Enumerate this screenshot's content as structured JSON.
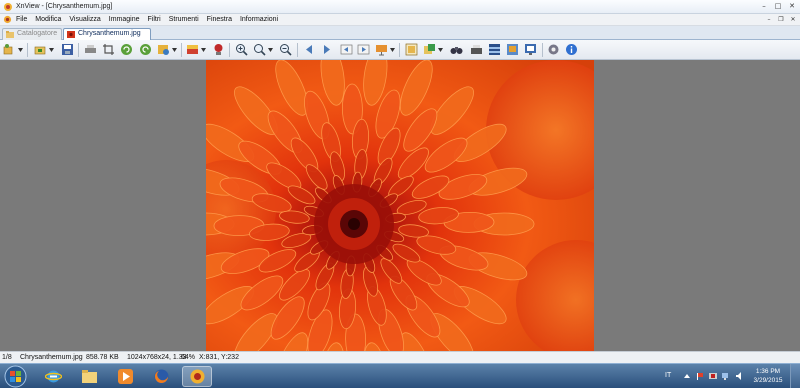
{
  "window": {
    "title": "XnView - [Chrysanthemum.jpg]",
    "controls": [
      "–",
      "□",
      "✕"
    ]
  },
  "menu": {
    "items": [
      "File",
      "Modifica",
      "Visualizza",
      "Immagine",
      "Filtri",
      "Strumenti",
      "Finestra",
      "Informazioni"
    ],
    "mdi_controls": [
      "–",
      "❐",
      "✕"
    ]
  },
  "tabs": [
    {
      "label": "Catalogatore",
      "active": false
    },
    {
      "label": "Chrysanthemum.jpg",
      "active": true
    }
  ],
  "toolbar": {
    "icons": [
      "browser-icon",
      "open-folder-icon",
      "save-icon",
      "print-preview-icon",
      "crop-icon",
      "rotate-left-icon",
      "rotate-right-icon",
      "effects-icon",
      "adjust-icon",
      "stamp-icon",
      "zoom-in-icon",
      "zoom-icon",
      "zoom-out-icon",
      "previous-icon",
      "next-icon",
      "first-page-icon",
      "last-page-icon",
      "slideshow-icon",
      "fullscreen-icon",
      "convert-icon",
      "binoculars-icon",
      "scanner-icon",
      "film-strip-icon",
      "capture-icon",
      "screen-icon",
      "settings-icon",
      "info-icon"
    ]
  },
  "image": {
    "name": "Chrysanthemum.jpg",
    "dominant_color": "#e0420c"
  },
  "status": {
    "index": "1/8",
    "filename": "Chrysanthemum.jpg",
    "filesize": "858.78 KB",
    "dimensions": "1024x768x24, 1.33",
    "zoom": "64%",
    "coords": "X:831, Y:232"
  },
  "taskbar": {
    "apps": [
      "windows-explorer-icon",
      "internet-explorer-icon",
      "file-explorer-icon",
      "media-player-icon",
      "firefox-icon",
      "xnview-icon"
    ],
    "language": "IT",
    "time": "1:36 PM",
    "date": "3/29/2015"
  },
  "colors": {
    "accent": "#3b6ea5",
    "viewer_bg": "#7a7a7a",
    "taskbar": "#2f5686"
  }
}
